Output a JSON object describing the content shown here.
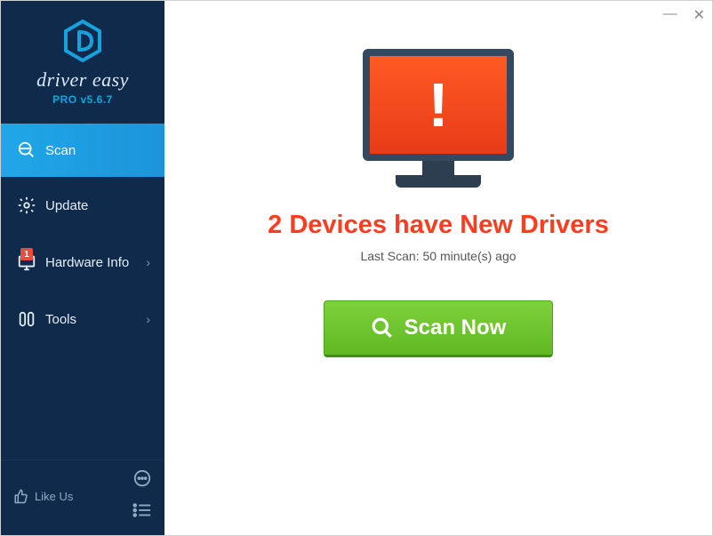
{
  "brand": {
    "name": "driver easy",
    "version": "PRO v5.6.7"
  },
  "sidebar": {
    "items": [
      {
        "label": "Scan"
      },
      {
        "label": "Update"
      },
      {
        "label": "Hardware Info",
        "badge": "1"
      },
      {
        "label": "Tools"
      }
    ],
    "like_label": "Like Us"
  },
  "main": {
    "heading": "2 Devices have New Drivers",
    "subheading": "Last Scan: 50 minute(s) ago",
    "scan_label": "Scan Now"
  }
}
